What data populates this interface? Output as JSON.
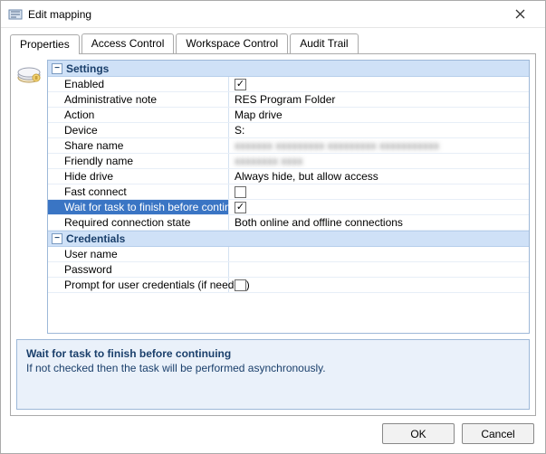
{
  "window": {
    "title": "Edit mapping"
  },
  "tabs": {
    "properties": "Properties",
    "access_control": "Access Control",
    "workspace_control": "Workspace Control",
    "audit_trail": "Audit Trail",
    "active": "properties"
  },
  "groups": {
    "settings": {
      "label": "Settings",
      "rows": {
        "enabled": {
          "label": "Enabled",
          "type": "check",
          "checked": true
        },
        "admin_note": {
          "label": "Administrative note",
          "type": "text",
          "value": "RES Program Folder"
        },
        "action": {
          "label": "Action",
          "type": "text",
          "value": "Map drive"
        },
        "device": {
          "label": "Device",
          "type": "text",
          "value": "S:"
        },
        "share_name": {
          "label": "Share name",
          "type": "blur",
          "value": "xxxxxxx xxxxxxxxx xxxxxxxxx xxxxxxxxxxx"
        },
        "friendly_name": {
          "label": "Friendly name",
          "type": "blur",
          "value": "xxxxxxxx xxxx"
        },
        "hide_drive": {
          "label": "Hide drive",
          "type": "text",
          "value": "Always hide, but allow access"
        },
        "fast_connect": {
          "label": "Fast connect",
          "type": "check",
          "checked": false
        },
        "wait_task": {
          "label": "Wait for task to finish before continuing",
          "type": "check",
          "checked": true,
          "selected": true
        },
        "req_conn": {
          "label": "Required connection state",
          "type": "text",
          "value": "Both online and offline connections"
        }
      }
    },
    "credentials": {
      "label": "Credentials",
      "rows": {
        "user_name": {
          "label": "User name",
          "type": "text",
          "value": ""
        },
        "password": {
          "label": "Password",
          "type": "text",
          "value": ""
        },
        "prompt": {
          "label": "Prompt for user credentials (if needed)",
          "type": "check",
          "checked": false
        }
      }
    }
  },
  "description": {
    "title": "Wait for task to finish before continuing",
    "text": "If not checked then the task will be performed asynchronously."
  },
  "buttons": {
    "ok": "OK",
    "cancel": "Cancel"
  }
}
